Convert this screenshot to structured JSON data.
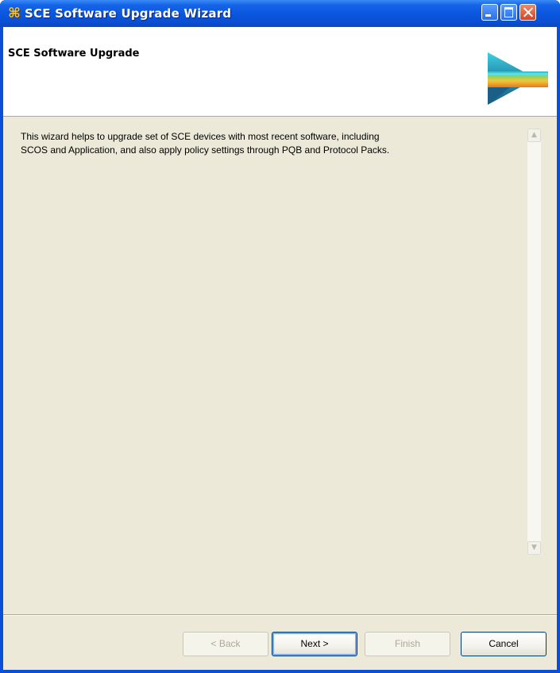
{
  "window": {
    "title": "SCE Software Upgrade Wizard",
    "app_icon": "cisco-asterisk-icon"
  },
  "header": {
    "title": "SCE Software Upgrade"
  },
  "content": {
    "description_line1": "This wizard helps to upgrade set of SCE devices with most recent software, including",
    "description_line2": "SCOS and Application, and also apply policy settings through PQB and Protocol Packs."
  },
  "buttons": {
    "back": "< Back",
    "next": "Next >",
    "finish": "Finish",
    "cancel": "Cancel"
  },
  "colors": {
    "titlebar": "#0a57df",
    "dialog_bg": "#ece9d8",
    "header_bg": "#ffffff"
  }
}
